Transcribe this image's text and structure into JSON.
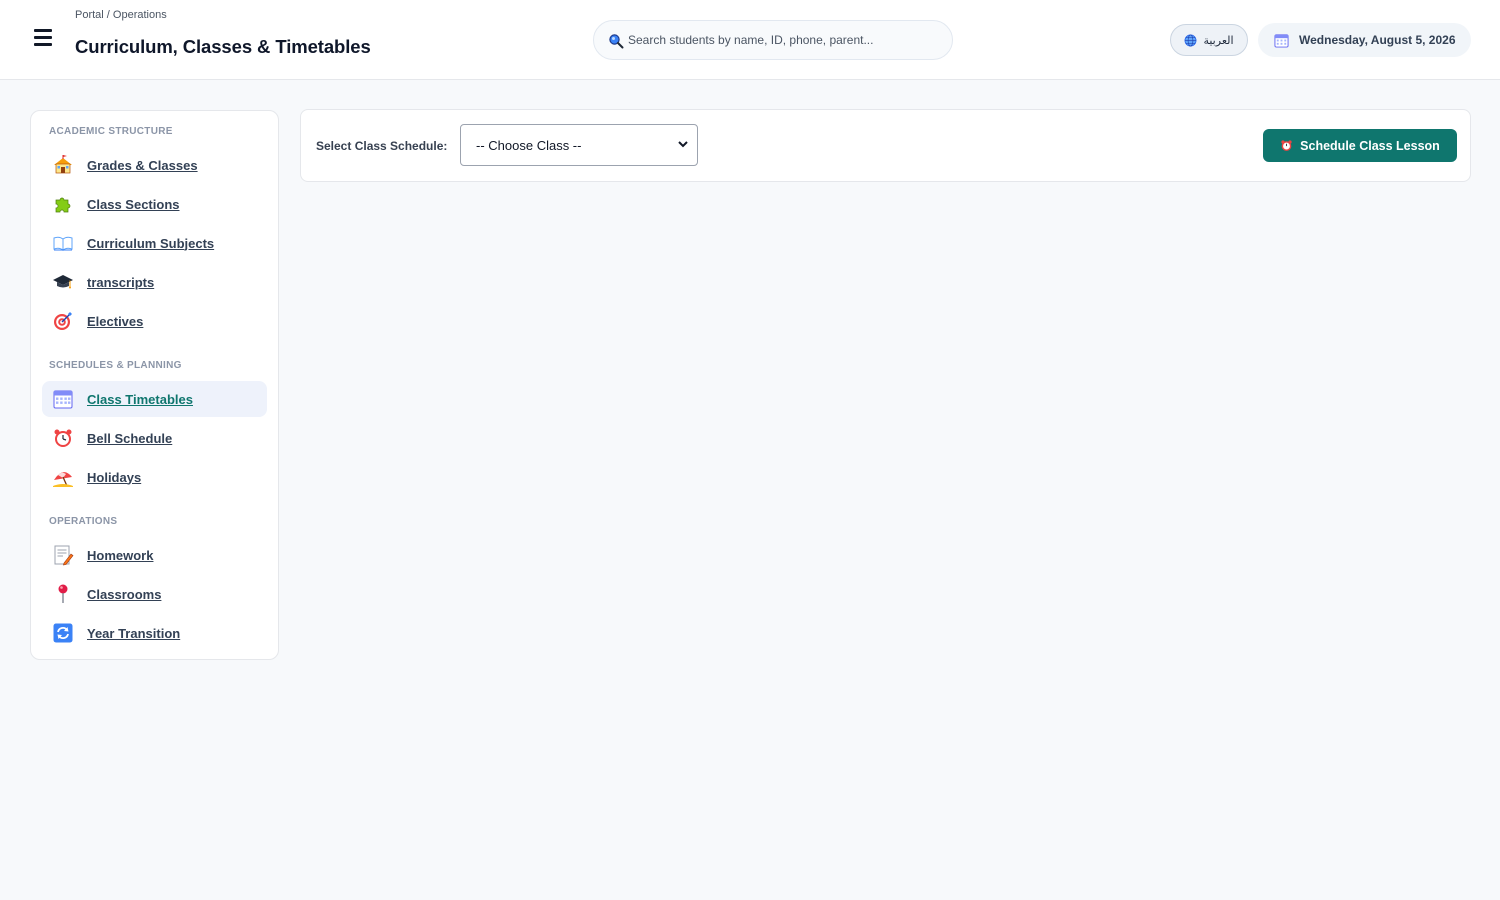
{
  "header": {
    "breadcrumb": "Portal / Operations",
    "title": "Curriculum, Classes & Timetables",
    "search_placeholder": "Search students by name, ID, phone, parent...",
    "language_label": "العربية",
    "date": "Wednesday, August 5, 2026"
  },
  "sidebar": {
    "sections": [
      {
        "label": "ACADEMIC STRUCTURE",
        "items": [
          {
            "label": "Grades & Classes",
            "icon": "school-icon"
          },
          {
            "label": "Class Sections",
            "icon": "puzzle-icon"
          },
          {
            "label": "Curriculum Subjects",
            "icon": "book-icon"
          },
          {
            "label": "transcripts",
            "icon": "graduation-cap-icon"
          },
          {
            "label": "Electives",
            "icon": "target-icon"
          }
        ]
      },
      {
        "label": "SCHEDULES & PLANNING",
        "items": [
          {
            "label": "Class Timetables",
            "icon": "calendar-icon",
            "active": true
          },
          {
            "label": "Bell Schedule",
            "icon": "alarm-clock-icon"
          },
          {
            "label": "Holidays",
            "icon": "beach-umbrella-icon"
          }
        ]
      },
      {
        "label": "OPERATIONS",
        "items": [
          {
            "label": "Homework",
            "icon": "memo-icon"
          },
          {
            "label": "Classrooms",
            "icon": "pushpin-icon"
          },
          {
            "label": "Year Transition",
            "icon": "refresh-icon"
          }
        ]
      }
    ]
  },
  "main": {
    "select_label": "Select Class Schedule:",
    "select_value": "-- Choose Class --",
    "schedule_button_label": "Schedule Class Lesson"
  },
  "colors": {
    "accent": "#0f766e",
    "active_bg": "#eef2fb"
  }
}
